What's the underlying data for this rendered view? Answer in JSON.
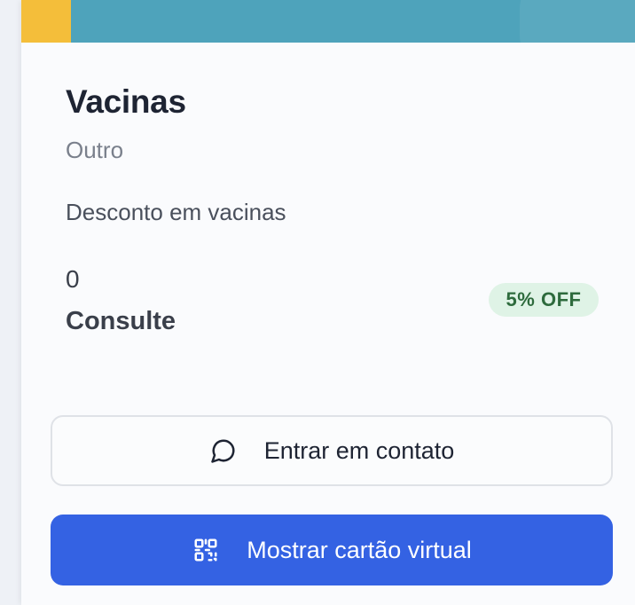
{
  "card": {
    "title": "Vacinas",
    "category": "Outro",
    "description": "Desconto em vacinas",
    "price_value": "0",
    "price_label": "Consulte",
    "badge": "5% OFF"
  },
  "actions": {
    "contact_label": "Entrar em contato",
    "contact_icon": "chat-bubble-icon",
    "card_label": "Mostrar cartão virtual",
    "card_icon": "qr-code-icon"
  },
  "colors": {
    "banner": "#4ea3bb",
    "banner_accent": "#f4be3a",
    "primary_button": "#3462e3",
    "badge_bg": "#dff3e6",
    "badge_text": "#2e6b3d"
  }
}
